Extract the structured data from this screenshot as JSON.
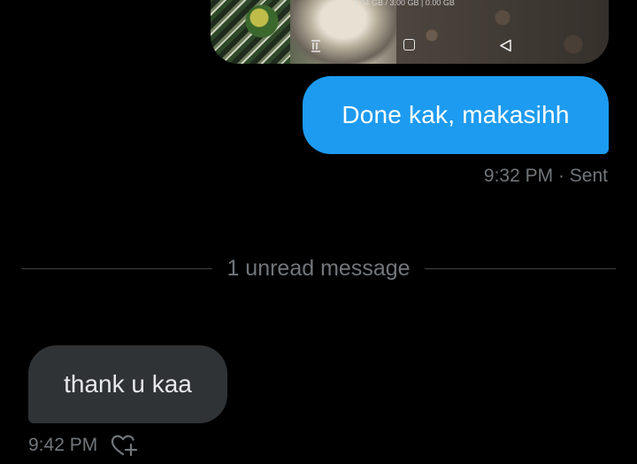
{
  "media": {
    "caption": "1.04 GB / 3.00 GB | 0.00 GB",
    "navbar": {
      "recents_icon": "recents-lines-icon",
      "home_icon": "home-square-icon",
      "back_icon": "back-triangle-icon"
    }
  },
  "messages": [
    {
      "direction": "sent",
      "text": "Done kak, makasihh",
      "time": "9:32 PM",
      "status": "Sent",
      "bubble_color": "#1d9bf0"
    },
    {
      "direction": "received",
      "text": "thank u kaa",
      "time": "9:42 PM",
      "reaction_icon": "heart-plus-icon",
      "bubble_color": "#2f3336"
    }
  ],
  "divider": {
    "label": "1 unread message"
  },
  "colors": {
    "background": "#000000",
    "meta_text": "#71767b",
    "divider_line": "#3e4144"
  }
}
